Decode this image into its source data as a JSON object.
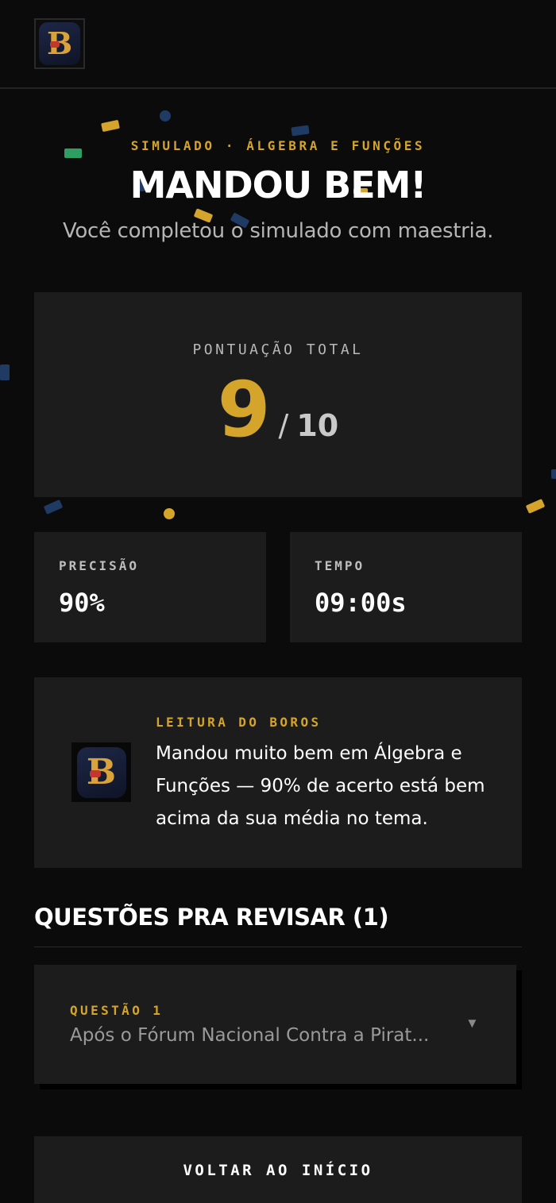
{
  "header": {
    "logo_letter": "B"
  },
  "hero": {
    "eyebrow": "SIMULADO · ÁLGEBRA E FUNÇÕES",
    "title": "MANDOU BEM!",
    "subtitle": "Você completou o simulado com maestria."
  },
  "score": {
    "label": "PONTUAÇÃO TOTAL",
    "value": "9",
    "slash": "/",
    "total": "10"
  },
  "stats": [
    {
      "label": "PRECISÃO",
      "value": "90%"
    },
    {
      "label": "TEMPO",
      "value": "09:00s"
    }
  ],
  "reading": {
    "label": "LEITURA DO BOROS",
    "text": "Mandou muito bem em Álgebra e Funções — 90% de acerto está bem acima da sua média no tema."
  },
  "review": {
    "title": "QUESTÕES PRA REVISAR (1)",
    "questions": [
      {
        "label": "QUESTÃO 1",
        "preview": "Após o Fórum Nacional Contra a Pirat..."
      }
    ]
  },
  "actions": {
    "home_label": "VOLTAR AO INÍCIO"
  },
  "colors": {
    "accent": "#d4a52a",
    "background": "#0b0b0b",
    "card": "#1c1c1c",
    "confetti_blue": "#1f3a63",
    "confetti_green": "#2e9e63"
  },
  "icons": {
    "logo": "boros-logo-icon",
    "chevron": "chevron-down-icon"
  }
}
